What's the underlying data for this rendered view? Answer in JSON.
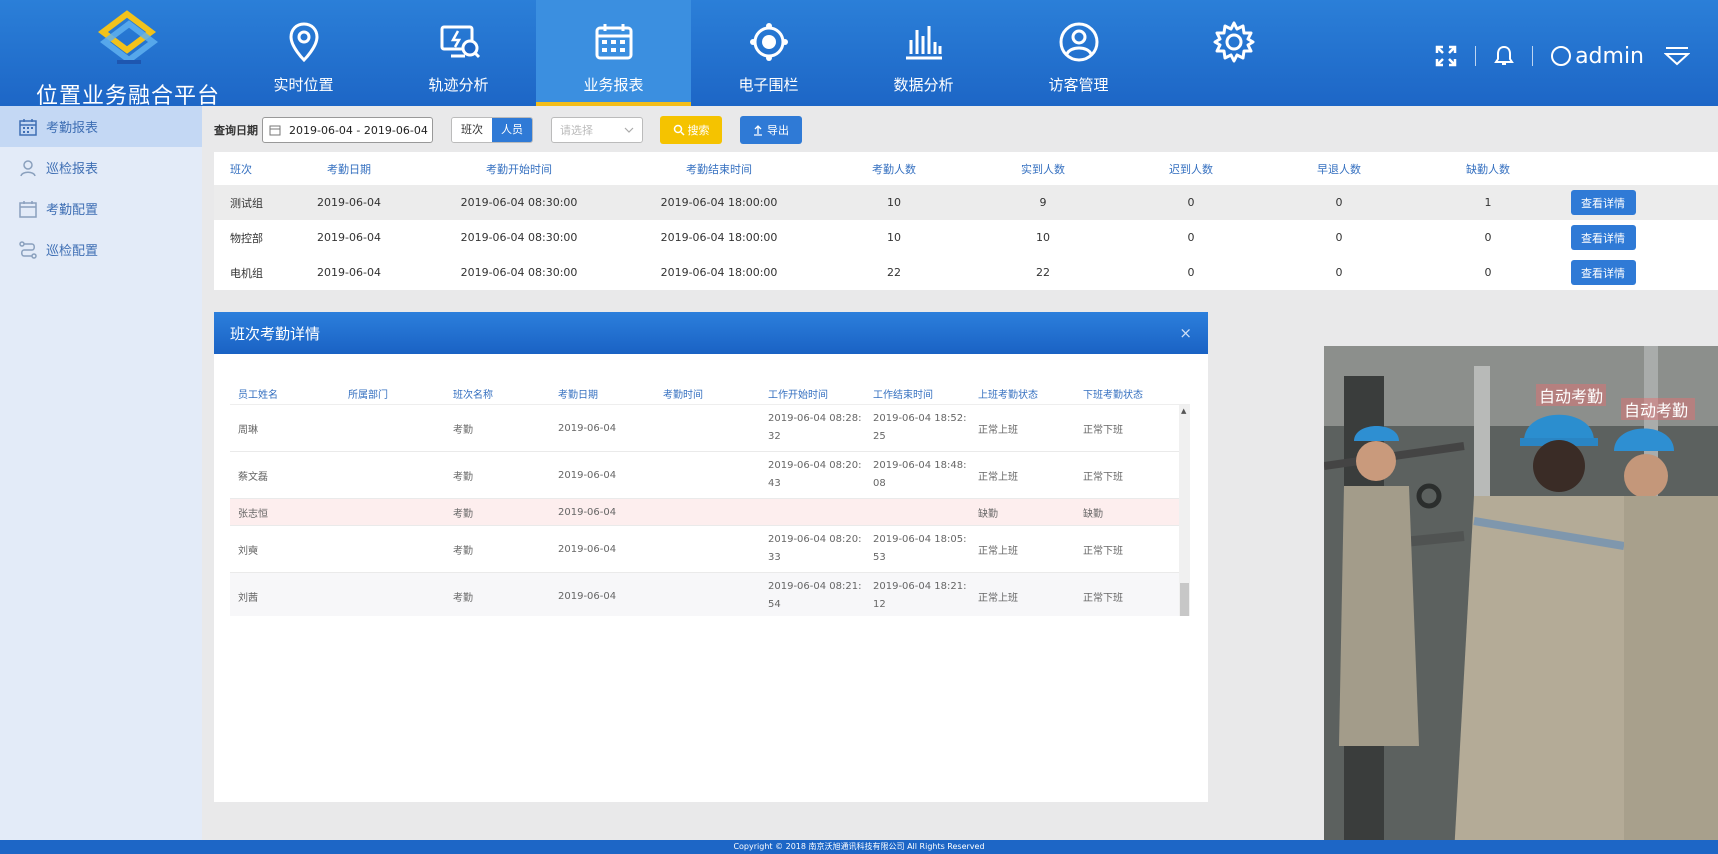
{
  "app": {
    "title": "位置业务融合平台"
  },
  "nav": [
    {
      "label": "实时位置",
      "icon": "map-pin-icon",
      "active": false
    },
    {
      "label": "轨迹分析",
      "icon": "monitor-trajectory-icon",
      "active": false
    },
    {
      "label": "业务报表",
      "icon": "calendar-report-icon",
      "active": true
    },
    {
      "label": "电子围栏",
      "icon": "geofence-icon",
      "active": false
    },
    {
      "label": "数据分析",
      "icon": "bar-chart-icon",
      "active": false
    },
    {
      "label": "访客管理",
      "icon": "user-circle-icon",
      "active": false
    },
    {
      "label": "",
      "icon": "gear-icon",
      "active": false
    }
  ],
  "header": {
    "user": "admin"
  },
  "sidebar": {
    "items": [
      {
        "label": "考勤报表",
        "icon": "calendar-icon",
        "active": true
      },
      {
        "label": "巡检报表",
        "icon": "location-person-icon",
        "active": false
      },
      {
        "label": "考勤配置",
        "icon": "calendar-config-icon",
        "active": false
      },
      {
        "label": "巡检配置",
        "icon": "route-icon",
        "active": false
      }
    ]
  },
  "toolbar": {
    "date_label": "查询日期",
    "date_range": "2019-06-04 - 2019-06-04",
    "seg_shift": "班次",
    "seg_person": "人员",
    "select_placeholder": "请选择",
    "search_label": "搜索",
    "export_label": "导出"
  },
  "table": {
    "headers": [
      "班次",
      "考勤日期",
      "考勤开始时间",
      "考勤结束时间",
      "考勤人数",
      "实到人数",
      "迟到人数",
      "早退人数",
      "缺勤人数"
    ],
    "rows": [
      {
        "shift": "测试组",
        "date": "2019-06-04",
        "start": "2019-06-04 08:30:00",
        "end": "2019-06-04 18:00:00",
        "total": "10",
        "present": "9",
        "late": "0",
        "early": "0",
        "absent": "1",
        "action": "查看详情"
      },
      {
        "shift": "物控部",
        "date": "2019-06-04",
        "start": "2019-06-04 08:30:00",
        "end": "2019-06-04 18:00:00",
        "total": "10",
        "present": "10",
        "late": "0",
        "early": "0",
        "absent": "0",
        "action": "查看详情"
      },
      {
        "shift": "电机组",
        "date": "2019-06-04",
        "start": "2019-06-04 08:30:00",
        "end": "2019-06-04 18:00:00",
        "total": "22",
        "present": "22",
        "late": "0",
        "early": "0",
        "absent": "0",
        "action": "查看详情"
      }
    ]
  },
  "modal": {
    "title": "班次考勤详情",
    "close": "×",
    "headers": [
      "员工姓名",
      "所属部门",
      "班次名称",
      "考勤日期",
      "考勤时间",
      "工作开始时间",
      "工作结束时间",
      "上班考勤状态",
      "下班考勤状态"
    ],
    "rows": [
      {
        "name": "周琳",
        "dept": "",
        "shift": "考勤",
        "date": "2019-06-04",
        "time": "",
        "start": "2019-06-04 08:28:32",
        "end": "2019-06-04 18:52:25",
        "in": "正常上班",
        "out": "正常下班"
      },
      {
        "name": "蔡文磊",
        "dept": "",
        "shift": "考勤",
        "date": "2019-06-04",
        "time": "",
        "start": "2019-06-04 08:20:43",
        "end": "2019-06-04 18:48:08",
        "in": "正常上班",
        "out": "正常下班"
      },
      {
        "name": "张志恒",
        "dept": "",
        "shift": "考勤",
        "date": "2019-06-04",
        "time": "",
        "start": "",
        "end": "",
        "in": "缺勤",
        "out": "缺勤"
      },
      {
        "name": "刘奭",
        "dept": "",
        "shift": "考勤",
        "date": "2019-06-04",
        "time": "",
        "start": "2019-06-04 08:20:33",
        "end": "2019-06-04 18:05:53",
        "in": "正常上班",
        "out": "正常下班"
      },
      {
        "name": "刘茜",
        "dept": "",
        "shift": "考勤",
        "date": "2019-06-04",
        "time": "",
        "start": "2019-06-04 08:21:54",
        "end": "2019-06-04 18:21:12",
        "in": "正常上班",
        "out": "正常下班"
      }
    ]
  },
  "video": {
    "tag1": "自动考勤",
    "tag2": "自动考勤"
  },
  "footer": {
    "copyright": "Copyright © 2018   南京沃旭通讯科技有限公司 All Rights Reserved"
  },
  "colors": {
    "primary": "#2f7ad6",
    "header": "#1d66c6",
    "accent": "#f3bd1a",
    "search": "#f5c300"
  }
}
